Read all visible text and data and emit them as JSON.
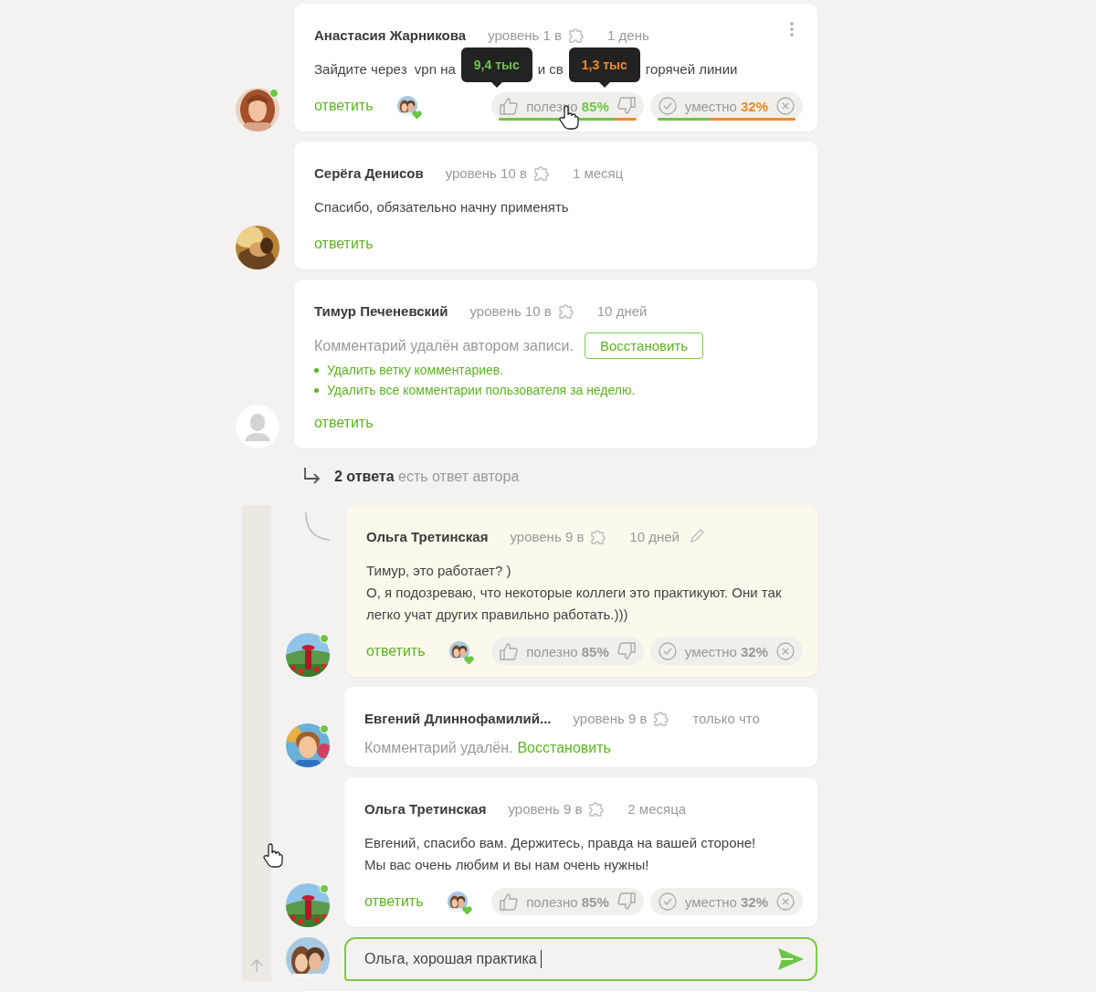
{
  "comments": [
    {
      "author": "Анастасия Жарникова",
      "rank": "уровень 1 в",
      "time": "1 день",
      "online": true,
      "menu": true,
      "kind": "text",
      "text": [
        "Зайдите через  vpn на",
        "и св",
        "горячей линии"
      ],
      "reply": "ответить",
      "reactions": {
        "active": true,
        "useful": {
          "label": "полезно",
          "share": "85%",
          "level": 0.85,
          "tooltip": "9,4 тыс"
        },
        "useless": {
          "tooltip": "1,3 тыс"
        },
        "appropriate": {
          "label": "уместно",
          "share": "32%",
          "level": 0.38
        }
      }
    },
    {
      "author": "Серёга Денисов",
      "rank": "уровень 10 в",
      "time": "1 месяц",
      "online": false,
      "kind": "text",
      "text": "Спасибо, обязательно начну применять",
      "reply": "ответить"
    },
    {
      "author": "Тимур Печеневский",
      "rank": "уровень 10 в",
      "time": "10 дней",
      "avatar": {
        "kind": "silhouette"
      },
      "online": false,
      "kind": "deleted_by_author",
      "notice": "Комментарий удалён автором записи.",
      "restore": "Восстановить",
      "actions": [
        "Удалить ветку комментариев.",
        "Удалить все комментарии пользователя за неделю."
      ],
      "reply": "ответить"
    }
  ],
  "replies_toggle": "**2 ответа** есть ответ автора",
  "thread": {
    "comments": [
      {
        "author": "Ольга Третинская",
        "rank": "уровень 9 в",
        "time": "10 дней",
        "edited": true,
        "highlighted": true,
        "online": true,
        "kind": "text",
        "text": "Тимур, это работает? )\nО, я подозреваю, что некоторые коллеги это практикуют. Они так легко учат других правильно работать.)))",
        "reply": "ответить",
        "reactions": {
          "active": false,
          "useful": {
            "label": "полезно",
            "share": "85%"
          },
          "appropriate": {
            "label": "уместно",
            "share": "32%"
          }
        }
      },
      {
        "author": "Евгений Длиннофамилий...",
        "rank": "уровень 9 в",
        "time": "только что",
        "highlighted": false,
        "online": true,
        "kind": "deleted",
        "notice": "Комментарий удалён.",
        "restore": "Восстановить"
      },
      {
        "author": "Ольга Третинская",
        "rank": "уровень 9 в",
        "time": "2 месяца",
        "highlighted": false,
        "online": true,
        "kind": "text",
        "text": "Евгений, спасибо вам. Держитесь, правда на вашей стороне!\nМы вас очень любим и вы нам очень нужны!",
        "reply": "ответить",
        "reactions": {
          "active": false,
          "useful": {
            "label": "полезно",
            "share": "85%"
          },
          "appropriate": {
            "label": "уместно",
            "share": "32%"
          }
        }
      }
    ],
    "composer": {
      "value": "Ольга, хорошая практика"
    }
  }
}
